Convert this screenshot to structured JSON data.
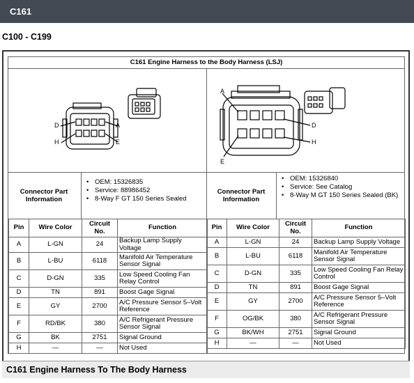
{
  "header": {
    "title": "C161"
  },
  "range_heading": "C100 - C199",
  "doc_title": "C161 Engine Harness to the Body Harness (LSJ)",
  "left": {
    "cpi_label": "Connector Part Information",
    "info": [
      "OEM: 15326835",
      "Service: 88986452",
      "8-Way F GT 150 Series Sealed"
    ],
    "diagram_labels": {
      "d": "D",
      "a": "A",
      "h": "H",
      "e": "E"
    }
  },
  "right": {
    "cpi_label": "Connector Part Information",
    "info": [
      "OEM: 15326840",
      "Service: See Catalog",
      "8-Way M GT 150 Series Sealed (BK)"
    ],
    "diagram_labels": {
      "a": "A",
      "d": "D",
      "h": "H",
      "e": "E"
    }
  },
  "columns": {
    "pin": "Pin",
    "wire": "Wire Color",
    "circuit": "Circuit No.",
    "function": "Function"
  },
  "left_rows": [
    {
      "pin": "A",
      "wire": "L-GN",
      "circuit": "24",
      "function": "Backup Lamp Supply Voltage"
    },
    {
      "pin": "B",
      "wire": "L-BU",
      "circuit": "6118",
      "function": "Manifold Air Temperature Sensor Signal"
    },
    {
      "pin": "C",
      "wire": "D-GN",
      "circuit": "335",
      "function": "Low Speed Cooling Fan Relay Control"
    },
    {
      "pin": "D",
      "wire": "TN",
      "circuit": "891",
      "function": "Boost Gage Signal"
    },
    {
      "pin": "E",
      "wire": "GY",
      "circuit": "2700",
      "function": "A/C Pressure Sensor 5–Volt Reference"
    },
    {
      "pin": "F",
      "wire": "RD/BK",
      "circuit": "380",
      "function": "A/C Refrigerant Pressure Sensor Signal"
    },
    {
      "pin": "G",
      "wire": "BK",
      "circuit": "2751",
      "function": "Signal Ground"
    },
    {
      "pin": "H",
      "wire": "—",
      "circuit": "—",
      "function": "Not Used"
    }
  ],
  "right_rows": [
    {
      "pin": "A",
      "wire": "L-GN",
      "circuit": "24",
      "function": "Backup Lamp Supply Voltage"
    },
    {
      "pin": "B",
      "wire": "L-BU",
      "circuit": "6118",
      "function": "Manifold Air Temperature Sensor Signal"
    },
    {
      "pin": "C",
      "wire": "D-GN",
      "circuit": "335",
      "function": "Low Speed Cooling Fan Relay Control"
    },
    {
      "pin": "D",
      "wire": "TN",
      "circuit": "891",
      "function": "Boost Gage Signal"
    },
    {
      "pin": "E",
      "wire": "GY",
      "circuit": "2700",
      "function": "A/C Pressure Sensor 5–Volt Reference"
    },
    {
      "pin": "F",
      "wire": "OG/BK",
      "circuit": "380",
      "function": "A/C Refrigerant Pressure Sensor Signal"
    },
    {
      "pin": "G",
      "wire": "BK/WH",
      "circuit": "2751",
      "function": "Signal Ground"
    },
    {
      "pin": "H",
      "wire": "—",
      "circuit": "—",
      "function": "Not Used"
    }
  ],
  "caption": "C161 Engine Harness To The Body Harness",
  "colors": {
    "header_bg": "#434a54",
    "caption_bg": "#ebebeb"
  }
}
